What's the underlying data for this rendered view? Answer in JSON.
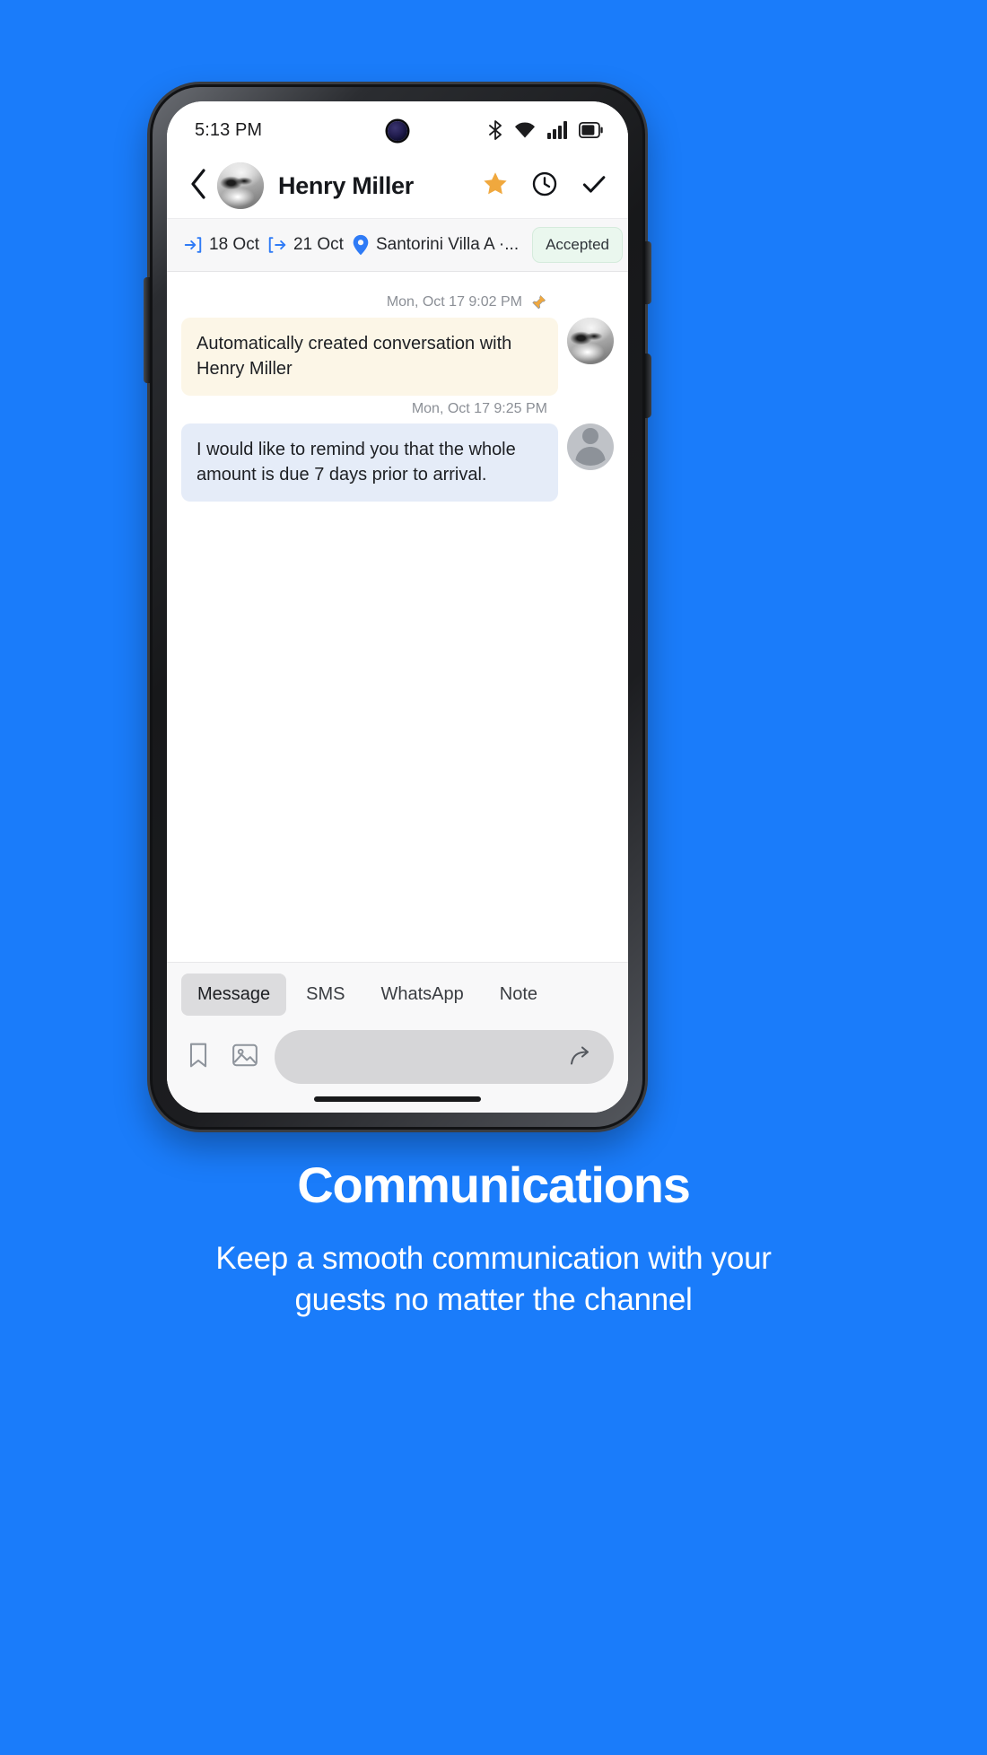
{
  "status_bar": {
    "time": "5:13 PM",
    "icons": [
      "bluetooth-icon",
      "wifi-icon",
      "cellular-signal-icon",
      "battery-icon"
    ]
  },
  "header": {
    "back_icon": "chevron-left-icon",
    "avatar": "contact-avatar",
    "title": "Henry Miller",
    "actions": [
      {
        "name": "star-icon",
        "label": "Favorite"
      },
      {
        "name": "clock-icon",
        "label": "History"
      },
      {
        "name": "check-icon",
        "label": "Mark done"
      }
    ],
    "star_color": "#f0a83e"
  },
  "booking_bar": {
    "check_in_icon": "arrow-into-bracket-icon",
    "check_in": "18 Oct",
    "check_out_icon": "arrow-out-of-bracket-icon",
    "check_out": "21 Oct",
    "location_icon": "map-pin-icon",
    "location": "Santorini Villa A ·...",
    "status": "Accepted",
    "accent_color": "#2f7bf6",
    "status_bg": "#eaf7ee"
  },
  "conversation": {
    "messages": [
      {
        "timestamp": "Mon, Oct 17 9:02 PM",
        "pinned_icon": "pushpin-icon",
        "pinned": true,
        "text": "Automatically created conversation with Henry Miller",
        "bubble_style": "system",
        "bubble_color": "#fcf6e7",
        "avatar": "contact-avatar"
      },
      {
        "timestamp": "Mon, Oct 17 9:25 PM",
        "pinned": false,
        "text": "I would like to remind you that the whole amount is due 7 days prior to arrival.",
        "bubble_style": "info",
        "bubble_color": "#e5ecf8",
        "avatar": "default-user-avatar"
      }
    ]
  },
  "composer": {
    "tabs": [
      {
        "label": "Message",
        "active": true
      },
      {
        "label": "SMS",
        "active": false
      },
      {
        "label": "WhatsApp",
        "active": false
      },
      {
        "label": "Note",
        "active": false
      }
    ],
    "left_icons": [
      "bookmark-icon",
      "image-icon"
    ],
    "input_value": "",
    "input_placeholder": "",
    "send_icon": "send-arrow-icon"
  },
  "marketing": {
    "title": "Communications",
    "subtitle": "Keep a smooth communication with your guests no matter the channel",
    "background_color": "#1a7cfa"
  }
}
